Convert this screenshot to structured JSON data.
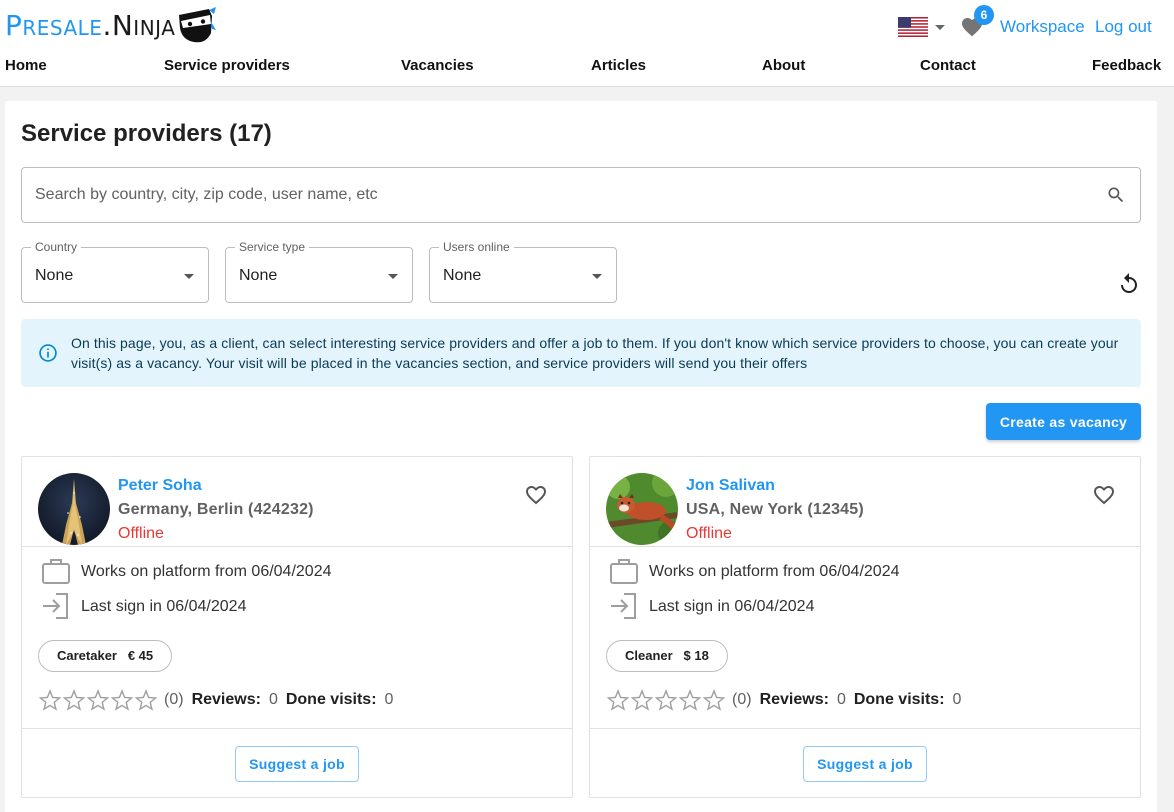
{
  "header": {
    "logo": {
      "part1": "Presale",
      "dot": ".",
      "part2": "Ninja"
    },
    "language": "en-US",
    "favorites_count": "6",
    "workspace_label": "Workspace",
    "logout_label": "Log out"
  },
  "nav": {
    "items": [
      {
        "label": "Home"
      },
      {
        "label": "Service providers"
      },
      {
        "label": "Vacancies"
      },
      {
        "label": "Articles"
      },
      {
        "label": "About"
      },
      {
        "label": "Contact"
      },
      {
        "label": "Feedback"
      }
    ]
  },
  "main": {
    "title": "Service providers (17)",
    "search_placeholder": "Search by country, city, zip code, user name, etc",
    "filters": [
      {
        "label": "Country",
        "value": "None"
      },
      {
        "label": "Service type",
        "value": "None"
      },
      {
        "label": "Users online",
        "value": "None"
      }
    ],
    "info": "On this page, you, as a client, can select interesting service providers and offer a job to them. If you don't know which service providers to choose, you can create your visit(s) as a vacancy. Your visit will be placed in the vacancies section, and service providers will send you their offers",
    "create_vacancy_label": "Create as vacancy"
  },
  "providers": [
    {
      "name": "Peter Soha",
      "location": "Germany, Berlin (424232)",
      "status": "Offline",
      "works_since": "Works on platform from 06/04/2024",
      "last_sign_in": "Last sign in 06/04/2024",
      "service": "Caretaker   € 45",
      "rating_count": "(0)",
      "reviews_label": "Reviews:",
      "reviews": "0",
      "done_label": "Done visits:",
      "done": "0",
      "rating": 0,
      "suggest_label": "Suggest a job"
    },
    {
      "name": "Jon Salivan",
      "location": "USA, New York (12345)",
      "status": "Offline",
      "works_since": "Works on platform from 06/04/2024",
      "last_sign_in": "Last sign in 06/04/2024",
      "service": "Cleaner   $ 18",
      "rating_count": "(0)",
      "reviews_label": "Reviews:",
      "reviews": "0",
      "done_label": "Done visits:",
      "done": "0",
      "rating": 0,
      "suggest_label": "Suggest a job"
    }
  ],
  "colors": {
    "accent": "#2196f3",
    "offline": "#e53935",
    "info_bg": "#e3f4fc"
  }
}
